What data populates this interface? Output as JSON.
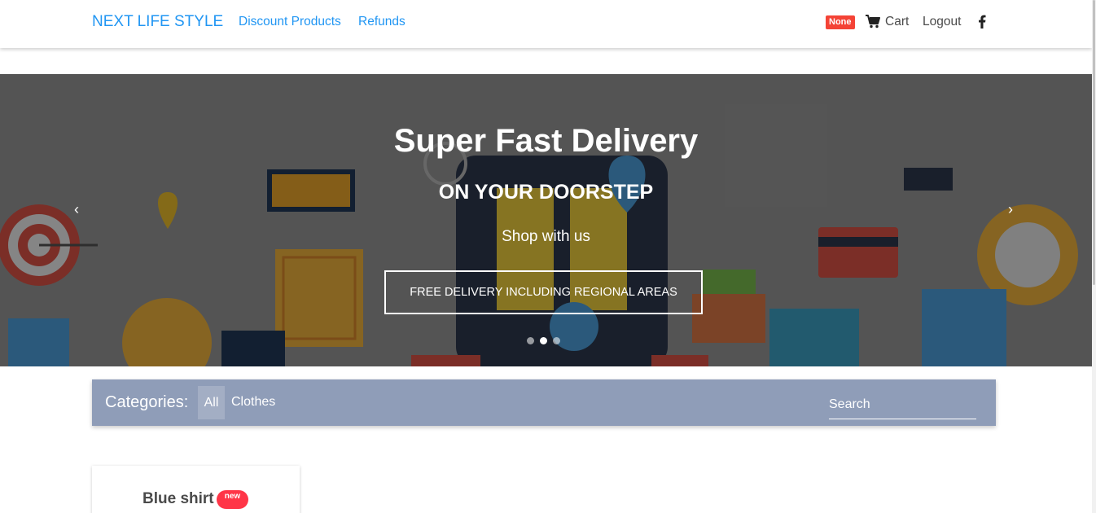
{
  "nav": {
    "brand": "NEXT LIFE STYLE",
    "links": [
      "Discount Products",
      "Refunds"
    ],
    "badge": "None",
    "cart_label": "Cart",
    "logout_label": "Logout",
    "link_color": "#2196f3",
    "badge_color": "#f44336"
  },
  "hero": {
    "title": "Super Fast Delivery",
    "subtitle": "ON YOUR DOORSTEP",
    "tagline": "Shop with us",
    "button_label": "FREE DELIVERY INCLUDING REGIONAL AREAS",
    "prev_icon": "chevron-left-icon",
    "next_icon": "chevron-right-icon",
    "slide_count": 3,
    "active_slide": 2
  },
  "categories": {
    "label": "Categories:",
    "items": [
      "All",
      "Clothes"
    ],
    "active": "All",
    "search_placeholder": "Search",
    "bar_color": "#8f9db8"
  },
  "products": [
    {
      "name": "Blue shirt",
      "badge": "new",
      "badge_color": "#ff3547"
    }
  ]
}
